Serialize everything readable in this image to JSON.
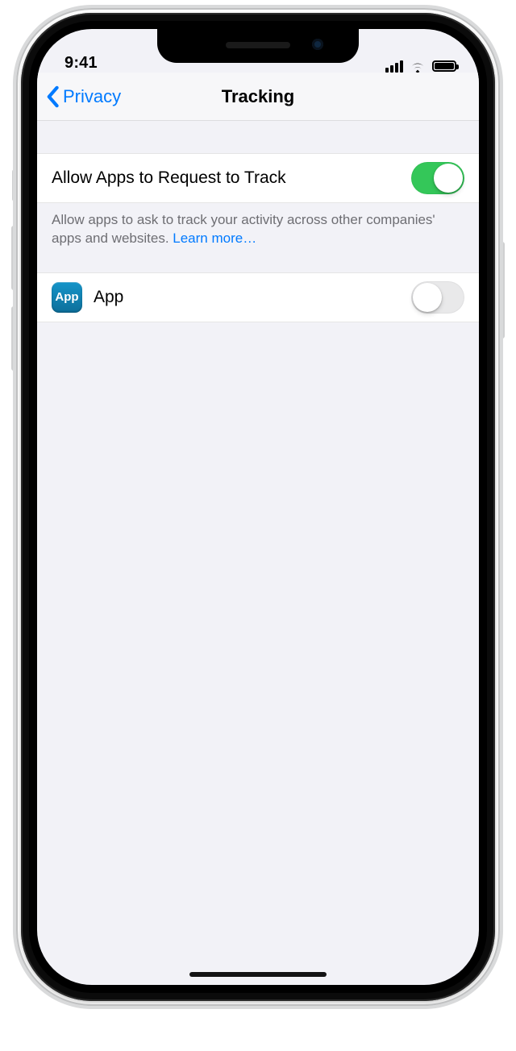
{
  "status": {
    "time": "9:41"
  },
  "nav": {
    "back_label": "Privacy",
    "title": "Tracking"
  },
  "settings": {
    "allow_track_label": "Allow Apps to Request to Track",
    "allow_track_on": true,
    "footer_text": "Allow apps to ask to track your activity across other companies' apps and websites. ",
    "learn_more_label": "Learn more…"
  },
  "apps": [
    {
      "icon_text": "App",
      "name": "App",
      "tracking_on": false
    }
  ]
}
